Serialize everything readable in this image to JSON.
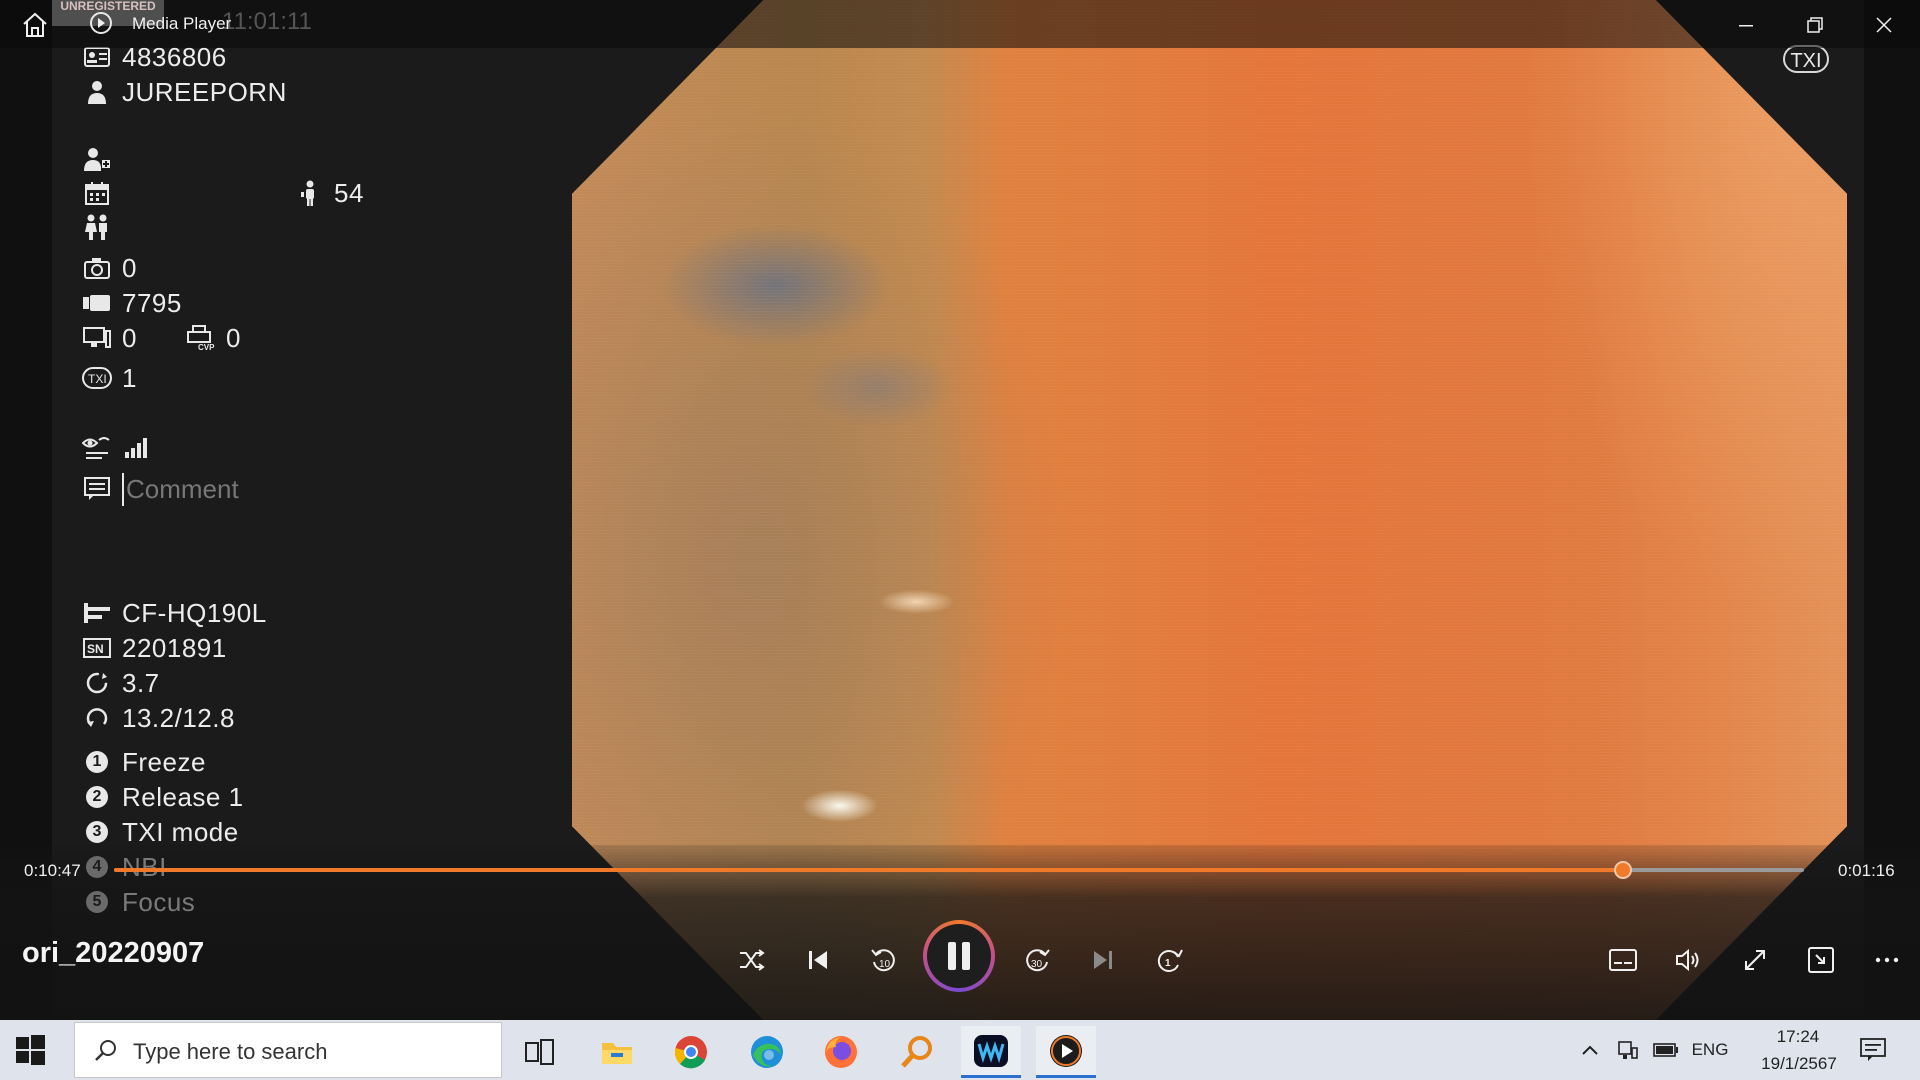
{
  "window": {
    "title": "Media Player",
    "unregistered_watermark": "UNREGISTERED",
    "ghost_time": "11:01:11"
  },
  "overlay": {
    "patient_id": "4836806",
    "patient_name": "JUREEPORN",
    "age": "54",
    "capture_count": "0",
    "counter": "7795",
    "monitor_count": "0",
    "cvp_count": "0",
    "txi_level": "1",
    "comment_placeholder": "Comment",
    "scope_model": "CF-HQ190L",
    "serial_number": "2201891",
    "value_a": "3.7",
    "value_b": "13.2/12.8",
    "buttons": [
      {
        "num": "1",
        "label": "Freeze"
      },
      {
        "num": "2",
        "label": "Release 1"
      },
      {
        "num": "3",
        "label": "TXI mode"
      },
      {
        "num": "4",
        "label": "NBI"
      },
      {
        "num": "5",
        "label": "Focus"
      }
    ],
    "txi_badge": "TXI"
  },
  "player": {
    "elapsed": "0:10:47",
    "remaining": "0:01:16",
    "progress": 0.893,
    "file_title": "ori_20220907",
    "accent": "#f07a2a"
  },
  "taskbar": {
    "search_placeholder": "Type here to search",
    "language": "ENG",
    "time": "17:24",
    "date": "19/1/2567"
  }
}
